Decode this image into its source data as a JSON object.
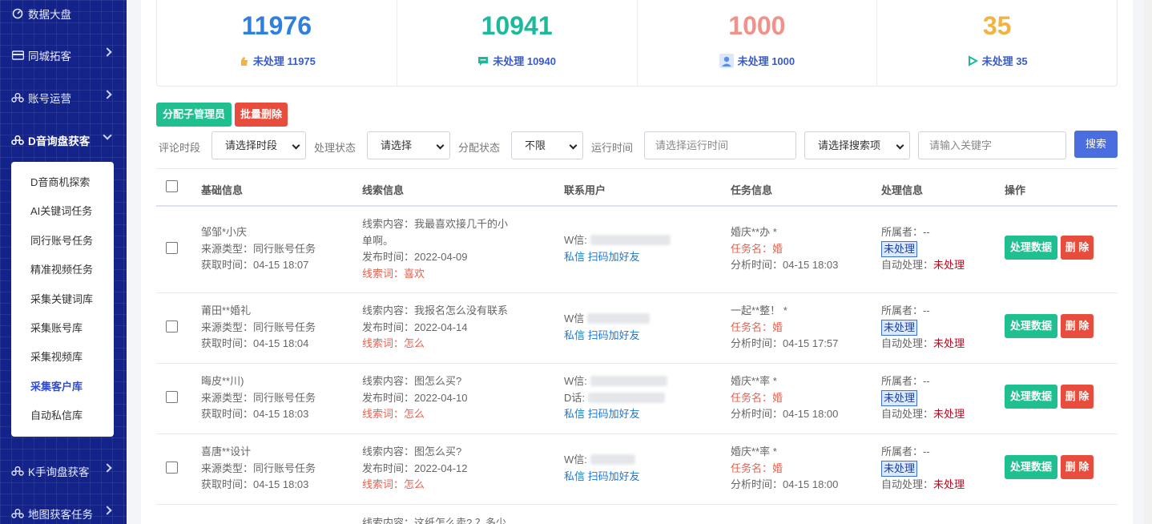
{
  "sidebar": {
    "items": [
      {
        "label": "数据大盘",
        "icon": "dashboard-icon"
      },
      {
        "label": "同城拓客",
        "icon": "card-icon"
      },
      {
        "label": "账号运营",
        "icon": "users-icon"
      },
      {
        "label": "D音询盘获客",
        "icon": "users-icon"
      },
      {
        "label": "K手询盘获客",
        "icon": "users-icon"
      },
      {
        "label": "地图获客任务",
        "icon": "users-icon"
      }
    ],
    "submenu": [
      "D音商机探索",
      "AI关键词任务",
      "同行账号任务",
      "精准视频任务",
      "采集关键词库",
      "采集账号库",
      "采集视频库",
      "采集客户库",
      "自动私信库"
    ]
  },
  "stats": [
    {
      "value": "11976",
      "sub": "未处理 11975",
      "color": "#2f7fe0",
      "icon": "hand-icon"
    },
    {
      "value": "10941",
      "sub": "未处理 10940",
      "color": "#1cb99a",
      "icon": "comment-icon"
    },
    {
      "value": "1000",
      "sub": "未处理 1000",
      "color": "#f0918a",
      "icon": "user-icon"
    },
    {
      "value": "35",
      "sub": "未处理 35",
      "color": "#f2b342",
      "icon": "play-icon"
    }
  ],
  "toolbar": {
    "assign": "分配子管理员",
    "batch_delete": "批量删除"
  },
  "filters": {
    "comment_time_label": "评论时段",
    "comment_time_value": "请选择时段",
    "process_label": "处理状态",
    "process_value": "请选择",
    "assign_label": "分配状态",
    "assign_value": "不限",
    "run_time_label": "运行时间",
    "run_time_placeholder": "请选择运行时间",
    "search_item_value": "请选择搜索项",
    "keyword_placeholder": "请输入关键字",
    "search_button": "搜索"
  },
  "table": {
    "headers": [
      "基础信息",
      "线索信息",
      "联系用户",
      "任务信息",
      "处理信息",
      "操作"
    ],
    "rows": [
      {
        "name": "邹邹*小庆",
        "source": "来源类型：同行账号任务",
        "fetched": "获取时间：04-15 18:07",
        "content1": "线索内容：我最喜欢接几千的小",
        "content2": "单啊。",
        "published": "发布时间：2022-04-09",
        "keyword": "线索词：喜欢",
        "w": "W信:",
        "d": "",
        "contact": "私信 扫码加好友",
        "task": "婚庆**办 *",
        "task_name": "任务名：婚",
        "analyzed": "分析时间：04-15 18:03",
        "owner": "所属者：--",
        "status": "未处理",
        "auto_label": "自动处理：",
        "auto_value": "未处理"
      },
      {
        "name": "莆田**婚礼",
        "source": "来源类型：同行账号任务",
        "fetched": "获取时间：04-15 18:04",
        "content1": "线索内容：我报名怎么没有联系",
        "content2": "",
        "published": "发布时间：2022-04-14",
        "keyword": "线索词：怎么",
        "w": "W信",
        "d": "",
        "contact": "私信 扫码加好友",
        "task": "一起**整！ *",
        "task_name": "任务名：婚",
        "analyzed": "分析时间：04-15 17:57",
        "owner": "所属者：--",
        "status": "未处理",
        "auto_label": "自动处理：",
        "auto_value": "未处理"
      },
      {
        "name": "晦皮**川)",
        "source": "来源类型：同行账号任务",
        "fetched": "获取时间：04-15 18:03",
        "content1": "线索内容：图怎么买?",
        "content2": "",
        "published": "发布时间：2022-04-10",
        "keyword": "线索词：怎么",
        "w": "W信:",
        "d": "D话:",
        "contact": "私信 扫码加好友",
        "task": "婚庆**率 *",
        "task_name": "任务名：婚",
        "analyzed": "分析时间：04-15 18:00",
        "owner": "所属者：--",
        "status": "未处理",
        "auto_label": "自动处理：",
        "auto_value": "未处理"
      },
      {
        "name": "喜唐**设计",
        "source": "来源类型：同行账号任务",
        "fetched": "获取时间：04-15 18:03",
        "content1": "线索内容：图怎么买?",
        "content2": "",
        "published": "发布时间：2022-04-12",
        "keyword": "线索词：怎么",
        "w": "W信:",
        "d": "",
        "contact": "私信 扫码加好友",
        "task": "婚庆**率 *",
        "task_name": "任务名：婚",
        "analyzed": "分析时间：04-15 18:00",
        "owner": "所属者：--",
        "status": "未处理",
        "auto_label": "自动处理：",
        "auto_value": "未处理"
      }
    ],
    "partial_row_content": "线索内容：这纸怎么卖? ？多少",
    "action_process": "处理数据",
    "action_delete": "删 除"
  }
}
